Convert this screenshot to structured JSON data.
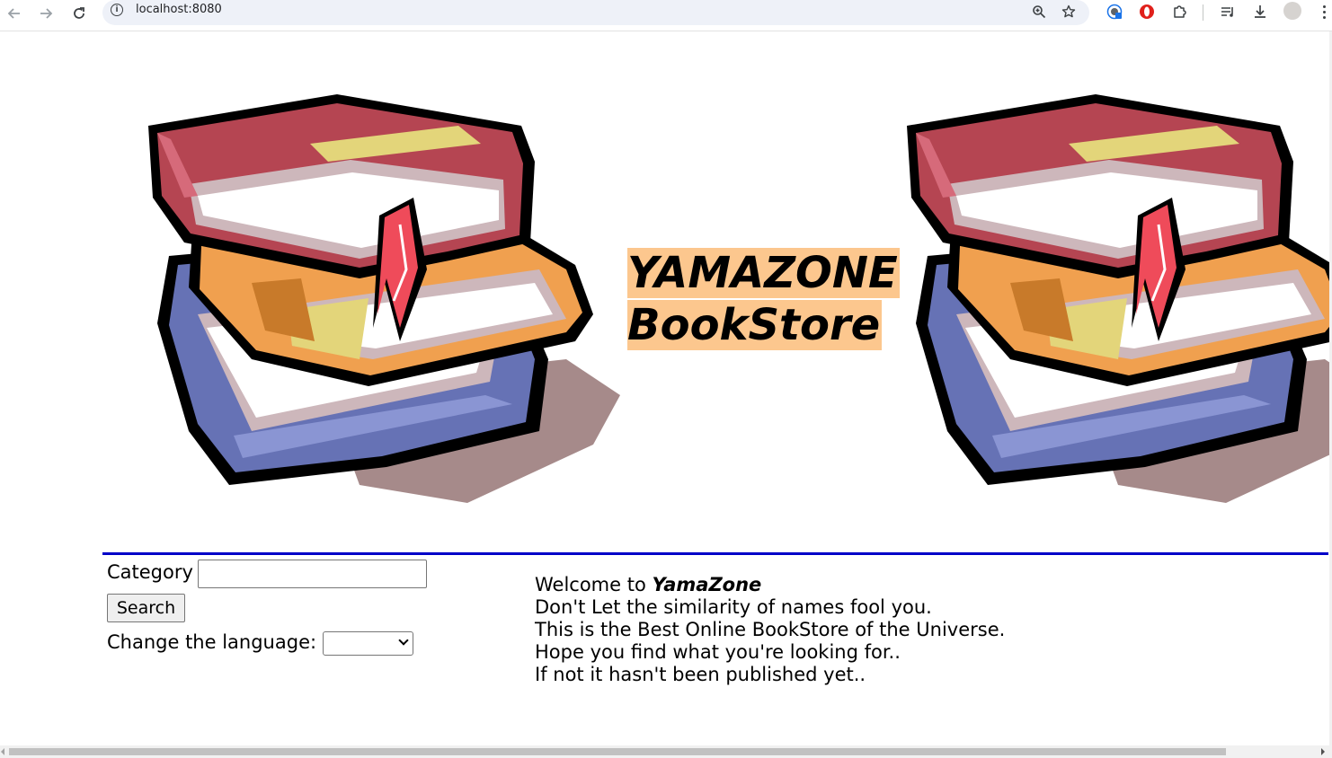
{
  "browser": {
    "url": "localhost:8080",
    "icons": {
      "back": "arrow-left-icon",
      "forward": "arrow-right-icon",
      "reload": "reload-icon",
      "site_info": "info-icon",
      "zoom": "zoom-icon",
      "bookmark": "star-icon",
      "extensions": [
        "translate-extension-icon",
        "opera-extension-icon",
        "puzzle-extensions-icon",
        "reading-list-icon",
        "download-icon"
      ],
      "profile": "avatar-icon",
      "menu": "kebab-menu-icon"
    }
  },
  "header": {
    "title_line1": "YAMAZONE",
    "title_line2": "BookStore",
    "title_highlight_color": "#fcc78e"
  },
  "divider_color": "#0000c8",
  "search_form": {
    "category_label": "Category",
    "category_value": "",
    "search_button": "Search",
    "language_label": "Change the language:",
    "language_value": ""
  },
  "welcome": {
    "prefix": "Welcome to ",
    "brand": "YamaZone",
    "lines": [
      "Don't Let the similarity of names fool you.",
      "This is the Best Online BookStore of the Universe.",
      "Hope you find what you're looking for..",
      "If not it hasn't been published yet.."
    ]
  }
}
